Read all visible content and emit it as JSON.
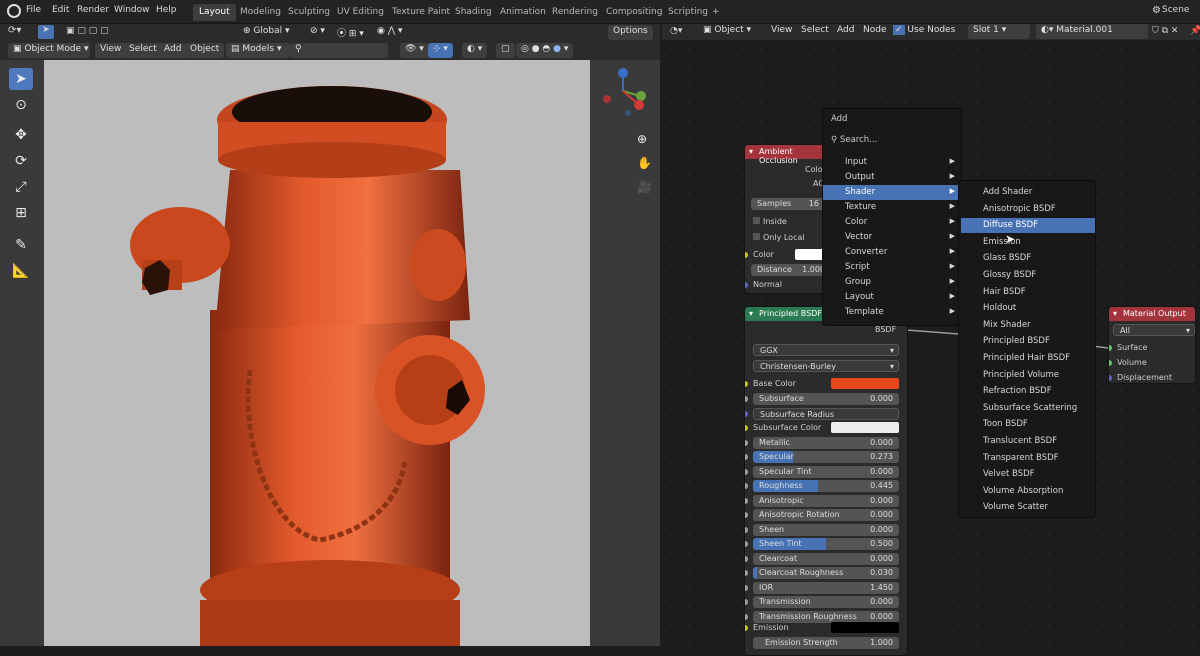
{
  "topbar": {
    "menus": [
      "File",
      "Edit",
      "Render",
      "Window",
      "Help"
    ],
    "workspaces": [
      "Layout",
      "Modeling",
      "Sculpting",
      "UV Editing",
      "Texture Paint",
      "Shading",
      "Animation",
      "Rendering",
      "Compositing",
      "Scripting"
    ],
    "active_workspace": "Layout",
    "add_tab": "+",
    "scene_label": "Scene"
  },
  "viewport_header": {
    "mode": "Object Mode",
    "view": "View",
    "select": "Select",
    "add": "Add",
    "object": "Object",
    "orientation": "Global",
    "collection": "Models",
    "options": "Options"
  },
  "node_header": {
    "type": "Object",
    "view": "View",
    "select": "Select",
    "add": "Add",
    "node": "Node",
    "use_nodes": "Use Nodes",
    "slot": "Slot 1",
    "material": "Material.001"
  },
  "ao_node": {
    "title": "Ambient Occlusion",
    "out_color": "Color",
    "out_ao": "AO",
    "samples_label": "Samples",
    "samples_value": "16",
    "inside": "Inside",
    "only_local": "Only Local",
    "color": "Color",
    "distance_label": "Distance",
    "distance_value": "1.000",
    "normal": "Normal"
  },
  "bsdf_node": {
    "title": "Principled BSDF",
    "output": "BSDF",
    "distribution": "GGX",
    "subsurface_method": "Christensen-Burley",
    "base_color_label": "Base Color",
    "base_color": "#e8481c",
    "subsurface_color_label": "Subsurface Color",
    "subsurface_radius": "Subsurface Radius",
    "params": [
      {
        "label": "Subsurface",
        "value": "0.000",
        "fill": 0
      },
      {
        "label": "Metallic",
        "value": "0.000",
        "fill": 0
      },
      {
        "label": "Specular",
        "value": "0.273",
        "fill": 0.273
      },
      {
        "label": "Specular Tint",
        "value": "0.000",
        "fill": 0
      },
      {
        "label": "Roughness",
        "value": "0.445",
        "fill": 0.445
      },
      {
        "label": "Anisotropic",
        "value": "0.000",
        "fill": 0
      },
      {
        "label": "Anisotropic Rotation",
        "value": "0.000",
        "fill": 0
      },
      {
        "label": "Sheen",
        "value": "0.000",
        "fill": 0
      },
      {
        "label": "Sheen Tint",
        "value": "0.500",
        "fill": 0.5
      },
      {
        "label": "Clearcoat",
        "value": "0.000",
        "fill": 0
      },
      {
        "label": "Clearcoat Roughness",
        "value": "0.030",
        "fill": 0.03
      },
      {
        "label": "IOR",
        "value": "1.450",
        "fill": 0
      },
      {
        "label": "Transmission",
        "value": "0.000",
        "fill": 0
      },
      {
        "label": "Transmission Roughness",
        "value": "0.000",
        "fill": 0
      }
    ],
    "emission_label": "Emission",
    "emission_strength_label": "Emission Strength",
    "emission_strength_value": "1.000"
  },
  "output_node": {
    "title": "Material Output",
    "target": "All",
    "inputs": [
      "Surface",
      "Volume",
      "Displacement"
    ]
  },
  "add_menu": {
    "title": "Add",
    "search": "Search...",
    "items": [
      "Input",
      "Output",
      "Shader",
      "Texture",
      "Color",
      "Vector",
      "Converter",
      "Script",
      "Group",
      "Layout",
      "Template"
    ],
    "highlighted": "Shader"
  },
  "shader_menu": {
    "items": [
      "Add Shader",
      "Anisotropic BSDF",
      "Diffuse BSDF",
      "Emission",
      "Glass BSDF",
      "Glossy BSDF",
      "Hair BSDF",
      "Holdout",
      "Mix Shader",
      "Principled BSDF",
      "Principled Hair BSDF",
      "Principled Volume",
      "Refraction BSDF",
      "Subsurface Scattering",
      "Toon BSDF",
      "Translucent BSDF",
      "Transparent BSDF",
      "Velvet BSDF",
      "Volume Absorption",
      "Volume Scatter"
    ],
    "highlighted": "Diffuse BSDF"
  }
}
